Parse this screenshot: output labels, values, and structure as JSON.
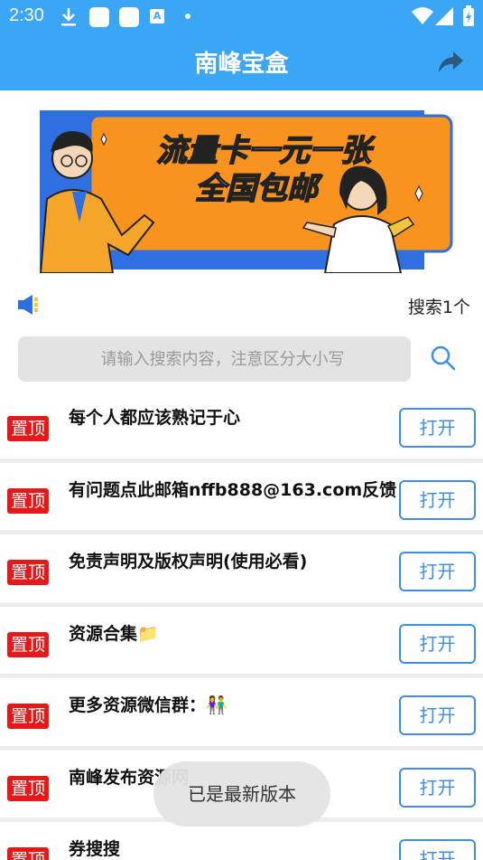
{
  "status_bar": {
    "time": "2:30",
    "icons": [
      "download-icon",
      "app-square-icon",
      "app-square-icon",
      "translate-icon",
      "dot-icon",
      "wifi-icon",
      "signal-icon",
      "battery-icon"
    ]
  },
  "header": {
    "title": "南峰宝盒",
    "share_icon": "share-icon"
  },
  "banner": {
    "line1": "流量卡一元一张",
    "line2": "全国包邮"
  },
  "promo": {
    "search_count": "搜索1个"
  },
  "search": {
    "placeholder": "请输入搜索内容，注意区分大小写"
  },
  "items": [
    {
      "badge": "置顶",
      "title": "每个人都应该熟记于心",
      "button": "打开"
    },
    {
      "badge": "置顶",
      "title": "有问题点此邮箱nffb888@163.com反馈",
      "button": "打开"
    },
    {
      "badge": "置顶",
      "title": "免责声明及版权声明(使用必看)",
      "button": "打开"
    },
    {
      "badge": "置顶",
      "title": "资源合集📁",
      "button": "打开"
    },
    {
      "badge": "置顶",
      "title": "更多资源微信群：👫",
      "button": "打开"
    },
    {
      "badge": "置顶",
      "title": "南峰发布资源网",
      "button": "打开"
    },
    {
      "badge": "置顶",
      "title": "券搜搜",
      "button": "打开"
    }
  ],
  "toast": "已是最新版本",
  "colors": {
    "primary": "#3aa6f5",
    "badge": "#e51919",
    "button": "#3a8fe8",
    "banner_orange": "#f7931e",
    "banner_blue": "#2f6fe0"
  }
}
